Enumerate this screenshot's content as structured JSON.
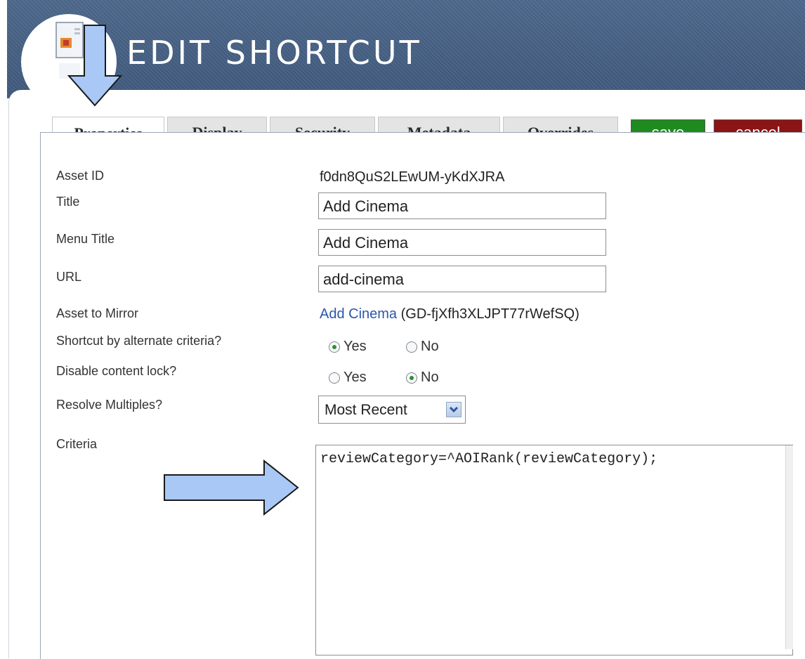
{
  "header": {
    "title": "EDIT SHORTCUT"
  },
  "tabs": [
    {
      "label": "Properties",
      "active": true
    },
    {
      "label": "Display"
    },
    {
      "label": "Security"
    },
    {
      "label": "Metadata"
    },
    {
      "label": "Overrides"
    }
  ],
  "buttons": {
    "save": {
      "label": "save",
      "color": "#1f8b1f"
    },
    "cancel": {
      "label": "cancel",
      "color": "#8b1414"
    }
  },
  "fields": {
    "asset_id": {
      "label": "Asset ID",
      "value": "f0dn8QuS2LEwUM-yKdXJRA"
    },
    "title": {
      "label": "Title",
      "value": "Add Cinema"
    },
    "menu_title": {
      "label": "Menu Title",
      "value": "Add Cinema"
    },
    "url": {
      "label": "URL",
      "value": "add-cinema"
    },
    "asset_to_mirror": {
      "label": "Asset to Mirror",
      "link": "Add Cinema",
      "id": "(GD-fjXfh3XLJPT77rWefSQ)"
    },
    "shortcut_by_alternate": {
      "label": "Shortcut by alternate criteria?",
      "yes": "Yes",
      "no": "No",
      "selected": "Yes"
    },
    "disable_content_lock": {
      "label": "Disable content lock?",
      "yes": "Yes",
      "no": "No",
      "selected": "No"
    },
    "resolve_multiples": {
      "label": "Resolve Multiples?",
      "value": "Most Recent"
    },
    "criteria": {
      "label": "Criteria",
      "value": "reviewCategory=^AOIRank(reviewCategory);"
    }
  },
  "colors": {
    "header_bg": "#3d5679",
    "annotation_arrow": "#a9c8f5"
  },
  "icons": [
    "document-icon",
    "down-arrow-annotation",
    "right-arrow-annotation",
    "chevron-down-icon"
  ]
}
